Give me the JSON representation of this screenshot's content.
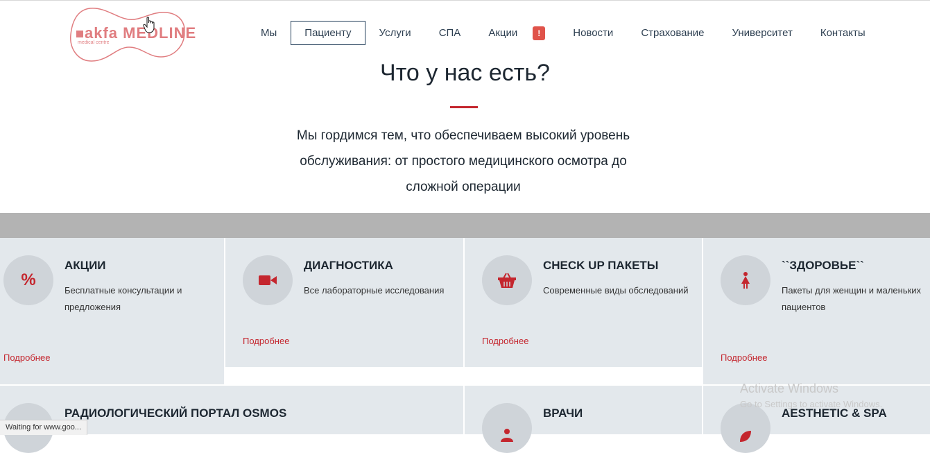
{
  "header": {
    "logo_text": "akfa MEDLINE",
    "logo_sub": "medical centre",
    "nav": [
      {
        "label": "Мы",
        "active": false
      },
      {
        "label": "Пациенту",
        "active": true
      },
      {
        "label": "Услуги",
        "active": false
      },
      {
        "label": "СПА",
        "active": false
      },
      {
        "label": "Акции",
        "active": false,
        "badge": "!"
      },
      {
        "label": "Новости",
        "active": false
      },
      {
        "label": "Страхование",
        "active": false
      },
      {
        "label": "Университет",
        "active": false
      },
      {
        "label": "Контакты",
        "active": false
      }
    ]
  },
  "hero": {
    "title": "Что у нас есть?",
    "subtitle": "Мы гордимся тем, что обеспечиваем высокий уровень обслуживания: от простого медицинского осмотра до сложной операции"
  },
  "cards": [
    {
      "icon": "percent-icon",
      "title": "АКЦИИ",
      "desc": "Бесплатные консультации и предложения",
      "link": "Подробнее"
    },
    {
      "icon": "video-camera-icon",
      "title": "ДИАГНОСТИКА",
      "desc": "Все лабораторные исследования",
      "link": "Подробнее"
    },
    {
      "icon": "basket-icon",
      "title": "CHECK UP ПАКЕТЫ",
      "desc": "Современные виды обследований",
      "link": "Подробнее"
    },
    {
      "icon": "female-icon",
      "title": "``ЗДОРОВЬЕ``",
      "desc": "Пакеты для женщин и маленьких пациентов",
      "link": "Подробнее"
    },
    {
      "icon": "",
      "title": "РАДИОЛОГИЧЕСКИЙ ПОРТАЛ OSMOS",
      "desc": "",
      "link": ""
    },
    {
      "icon": "doctor-icon",
      "title": "ВРАЧИ",
      "desc": "",
      "link": ""
    },
    {
      "icon": "leaf-icon",
      "title": "AESTHETIC & SPA",
      "desc": "",
      "link": ""
    }
  ],
  "os": {
    "watermark_title": "Activate Windows",
    "watermark_sub": "Go to Settings to activate Windows.",
    "status": "Waiting for www.goo..."
  },
  "colors": {
    "accent": "#c4262e",
    "card_bg": "#e3e8ec",
    "icon_circle": "#cfd4d9",
    "band": "#b3b3b3"
  }
}
